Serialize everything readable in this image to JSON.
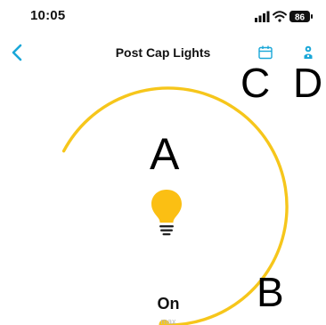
{
  "status_bar": {
    "time": "10:05",
    "battery": "86",
    "icons": [
      "signal-icon",
      "wifi-icon",
      "battery-icon"
    ]
  },
  "nav": {
    "title": "Post Cap Lights",
    "back_icon": "chevron-left-icon",
    "actions": [
      "calendar-icon",
      "settings-icon"
    ]
  },
  "annotations": {
    "a": "A",
    "b": "B",
    "c": "C",
    "d": "D"
  },
  "control": {
    "state": "On",
    "sublabel": "max",
    "brightness_fraction": 1.0,
    "bulb_icon": "light-bulb-icon"
  },
  "colors": {
    "accent": "#1aa7d8",
    "dial": "#f6c61b",
    "bulb": "#fbbf13"
  }
}
